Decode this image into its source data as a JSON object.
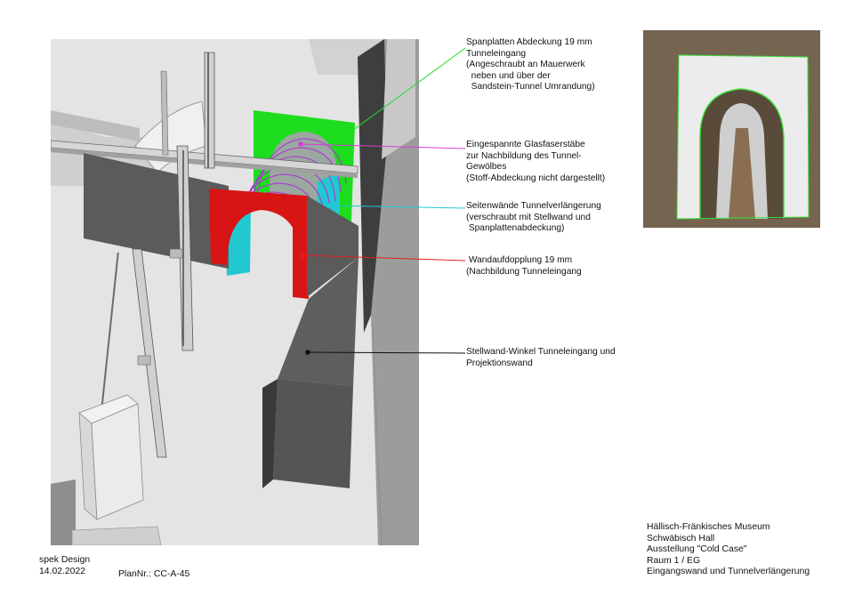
{
  "callouts": [
    {
      "id": "c1",
      "color": "#22dd22",
      "lines": [
        "Spanplatten Abdeckung 19 mm",
        "Tunneleingang",
        "(Angeschraubt an Mauerwerk",
        "  neben und über der",
        "  Sandstein-Tunnel Umrandung)"
      ]
    },
    {
      "id": "c2",
      "color": "#d83ad8",
      "lines": [
        "Eingespannte Glasfaserstäbe",
        "zur Nachbildung des Tunnel-",
        "Gewölbes",
        "(Stoff-Abdeckung nicht dargestellt)"
      ]
    },
    {
      "id": "c3",
      "color": "#22c8d8",
      "lines": [
        "Seitenwände Tunnelverlängerung",
        "(verschraubt mit Stellwand und",
        " Spanplattenabdeckung)"
      ]
    },
    {
      "id": "c4",
      "color": "#e02020",
      "lines": [
        " Wandaufdopplung 19 mm",
        "(Nachbildung Tunneleingang"
      ]
    },
    {
      "id": "c5",
      "color": "#111111",
      "lines": [
        "Stellwand-Winkel Tunneleingang und",
        "Projektionswand"
      ]
    }
  ],
  "footer": {
    "company": "spek Design",
    "date": "14.02.2022",
    "plan_number": "PlanNr.: CC-A-45",
    "project_info": [
      "Hällisch-Fränkisches Museum",
      "Schwäbisch Hall",
      "Ausstellung \"Cold Case\"",
      "Raum 1 / EG",
      "Eingangswand und Tunnelverlängerung"
    ]
  },
  "colors": {
    "green_panel": "#1edc1e",
    "red_wall": "#d81414",
    "cyan_wall": "#22c8d0",
    "magenta_rods": "#b030d8",
    "dark_wall": "#5b5b5b",
    "floor": "#dcdcdc"
  }
}
